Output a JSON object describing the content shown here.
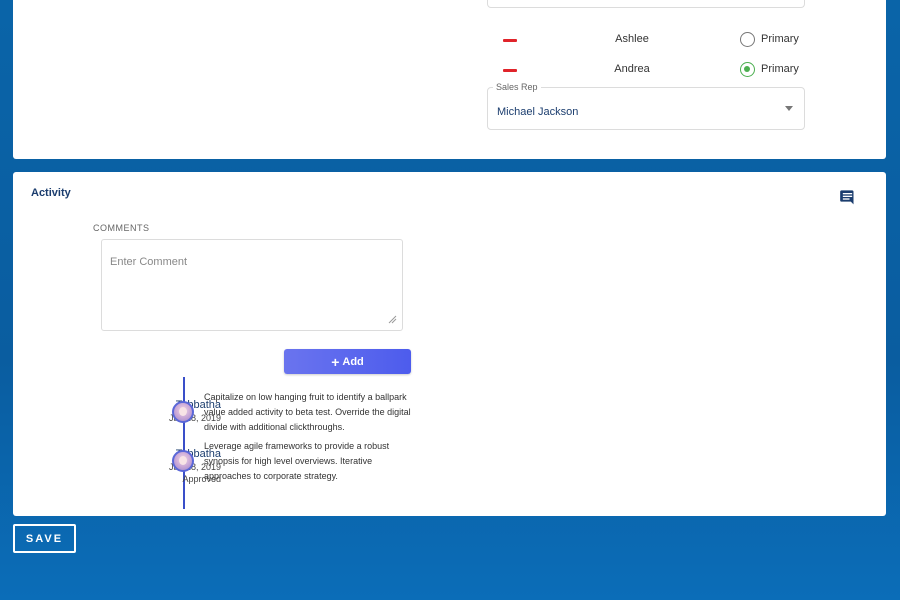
{
  "contacts": [
    {
      "name": "Ashlee",
      "primary_label": "Primary",
      "primary": false
    },
    {
      "name": "Andrea",
      "primary_label": "Primary",
      "primary": true
    }
  ],
  "sales_rep": {
    "label": "Sales Rep",
    "value": "Michael Jackson"
  },
  "activity": {
    "title": "Activity",
    "comments_label": "COMMENTS",
    "comment_placeholder": "Enter Comment",
    "add_label": "Add",
    "entries": [
      {
        "author": "Tabbatha",
        "date": "Jan 28, 2019",
        "status": "",
        "text": "Capitalize on low hanging fruit to identify a ballpark value added activity to beta test. Override the digital divide with additional clickthroughs."
      },
      {
        "author": "Tabbatha",
        "date": "Jan 28, 2019",
        "status": "Approved",
        "text": "Leverage agile frameworks to provide a robust synopsis for high level overviews. Iterative approaches to corporate strategy."
      }
    ]
  },
  "save_label": "SAVE",
  "colors": {
    "accent": "#4d5ced",
    "remove": "#e0242a",
    "primary_check": "#4caf50",
    "title": "#1b3d6e"
  },
  "icons": {
    "comment": "comment-icon",
    "remove": "remove-icon",
    "plus": "plus-icon"
  }
}
